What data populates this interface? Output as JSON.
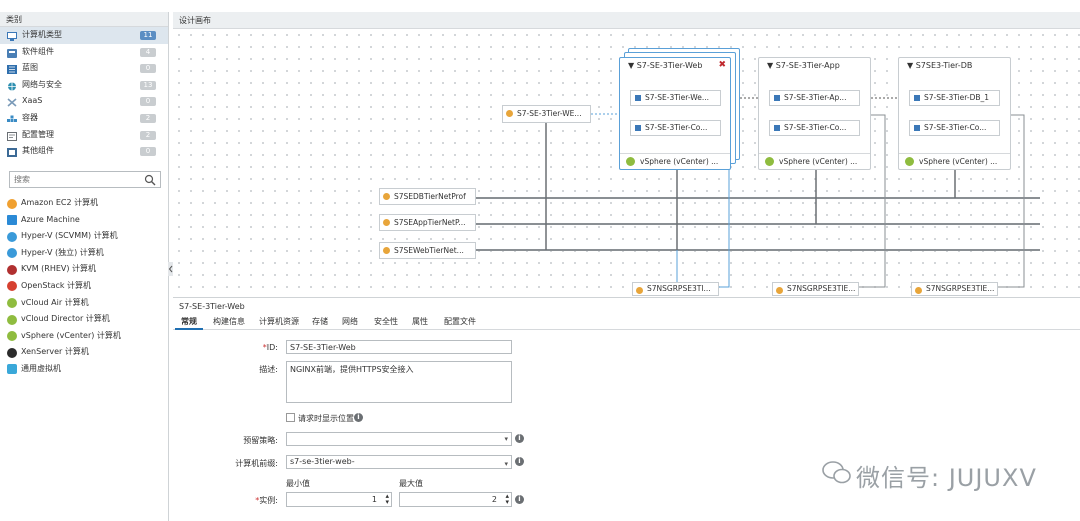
{
  "left_panel": {
    "header": "类别",
    "categories": [
      {
        "label": "计算机类型",
        "count": "11",
        "icon": "computer-type-icon",
        "color": "#3b78b8"
      },
      {
        "label": "软件组件",
        "count": "4",
        "icon": "software-icon",
        "color": "#4a7fb5"
      },
      {
        "label": "蓝图",
        "count": "0",
        "icon": "blueprint-icon",
        "color": "#2f6fad"
      },
      {
        "label": "网络与安全",
        "count": "13",
        "icon": "network-icon",
        "color": "#2d8fb0"
      },
      {
        "label": "XaaS",
        "count": "0",
        "icon": "xaas-icon",
        "color": "#7a9ab8"
      },
      {
        "label": "容器",
        "count": "2",
        "icon": "container-icon",
        "color": "#3a8bc4"
      },
      {
        "label": "配置管理",
        "count": "2",
        "icon": "config-icon",
        "color": "#6a6f74"
      },
      {
        "label": "其他组件",
        "count": "0",
        "icon": "other-icon",
        "color": "#3c6a96"
      }
    ],
    "search_placeholder": "搜索",
    "machines": [
      {
        "label": "Amazon EC2 计算机",
        "color": "#f0a030"
      },
      {
        "label": "Azure Machine",
        "color": "#2b8ad6"
      },
      {
        "label": "Hyper-V (SCVMM) 计算机",
        "color": "#3a9ad9"
      },
      {
        "label": "Hyper-V (独立) 计算机",
        "color": "#3a9ad9"
      },
      {
        "label": "KVM (RHEV) 计算机",
        "color": "#b03030"
      },
      {
        "label": "OpenStack 计算机",
        "color": "#d64030"
      },
      {
        "label": "vCloud Air 计算机",
        "color": "#8fbc3f"
      },
      {
        "label": "vCloud Director 计算机",
        "color": "#8fbc3f"
      },
      {
        "label": "vSphere (vCenter) 计算机",
        "color": "#8fbc3f"
      },
      {
        "label": "XenServer 计算机",
        "color": "#2b2b2b"
      },
      {
        "label": "通用虚拟机",
        "color": "#3aa8d9"
      }
    ]
  },
  "canvas": {
    "title": "设计画布",
    "nodes": [
      {
        "title": "S7-SE-3Tier-Web",
        "vm": "S7-SE-3Tier-We...",
        "comp": "S7-SE-3Tier-Co...",
        "footer": "vSphere (vCenter) ..."
      },
      {
        "title": "S7-SE-3Tier-App",
        "vm": "S7-SE-3Tier-Ap...",
        "comp": "S7-SE-3Tier-Co...",
        "footer": "vSphere (vCenter) ..."
      },
      {
        "title": "S7SE3-Tier-DB",
        "vm": "S7-SE-3Tier-DB_1",
        "comp": "S7-SE-3Tier-Co...",
        "footer": "vSphere (vCenter) ..."
      }
    ],
    "lb_label": "S7-SE-3Tier-WE...",
    "networks": [
      "S7SEDBTierNetProf",
      "S7SEAppTierNetP...",
      "S7SEWebTierNet..."
    ],
    "nsgs": [
      "S7NSGRPSE3TI...",
      "S7NSGRPSE3TIE...",
      "S7NSGRPSE3TIE..."
    ]
  },
  "props": {
    "title": "S7-SE-3Tier-Web",
    "tabs": [
      "常规",
      "构建信息",
      "计算机资源",
      "存储",
      "网络",
      "安全性",
      "属性",
      "配置文件"
    ],
    "id_label": "ID:",
    "id_value": "S7-SE-3Tier-Web",
    "desc_label": "描述:",
    "desc_value": "NGINX前端，提供HTTPS安全接入",
    "checkbox_label": "请求时显示位置",
    "reservation_label": "预留策略:",
    "reservation_value": "",
    "prefix_label": "计算机前缀:",
    "prefix_value": "s7-se-3tier-web-",
    "min_label": "最小值",
    "max_label": "最大值",
    "instances_label": "实例:",
    "min_value": "1",
    "max_value": "2"
  },
  "watermark": "微信号: JUJUXV"
}
